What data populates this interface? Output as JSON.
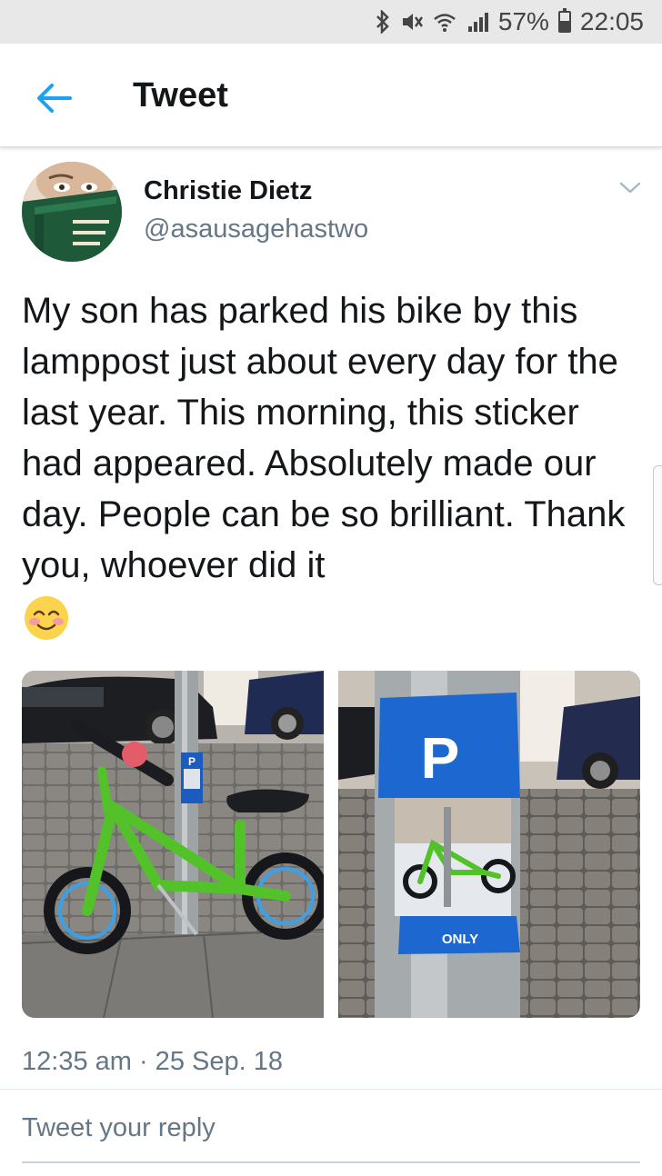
{
  "status_bar": {
    "battery_percent": "57%",
    "time": "22:05",
    "icons": [
      "bluetooth-icon",
      "mute-icon",
      "wifi-icon",
      "signal-icon",
      "battery-icon"
    ]
  },
  "header": {
    "title": "Tweet",
    "back_icon": "arrow-left-icon",
    "accent_color": "#1da1f2"
  },
  "tweet": {
    "author": {
      "name": "Christie Dietz",
      "handle": "@asausagehastwo"
    },
    "text": "My son has parked his bike by this lamppost just about every day for the last year. This morning, this sticker had appeared. Absolutely made our day. People can be so brilliant. Thank you, whoever did it",
    "emoji": "smiling-face-with-blush",
    "media": [
      {
        "description_icon": "photo-bike-at-lamppost",
        "sticker_label": "P"
      },
      {
        "description_icon": "photo-parking-sticker",
        "sticker_label": "P",
        "sticker_footer": "ONLY"
      }
    ],
    "timestamp": "12:35 am · 25 Sep. 18"
  },
  "reply": {
    "placeholder": "Tweet your reply"
  }
}
